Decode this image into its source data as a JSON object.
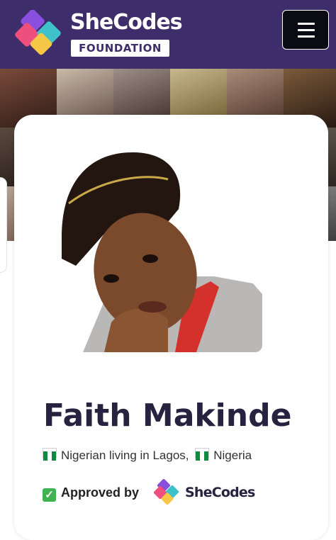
{
  "header": {
    "brand_name": "SheCodes",
    "brand_subtitle": "FOUNDATION",
    "menu_icon": "hamburger-menu-icon",
    "background_color": "#3d2d6b"
  },
  "profile": {
    "name": "Faith Makinde",
    "location_text": "Nigerian living in Lagos,",
    "country": "Nigeria",
    "flag_icon": "nigeria-flag-icon",
    "approved_label": "Approved by",
    "approved_icon": "check-mark-icon",
    "approver_brand": "SheCodes"
  },
  "colors": {
    "brand_purple": "#3d2d6b",
    "name_text": "#26223f",
    "logo_pink": "#ef4f7c",
    "logo_purple": "#8a4fdc",
    "logo_teal": "#3fc1c9",
    "logo_yellow": "#f6c646",
    "check_green": "#3fb34f"
  }
}
